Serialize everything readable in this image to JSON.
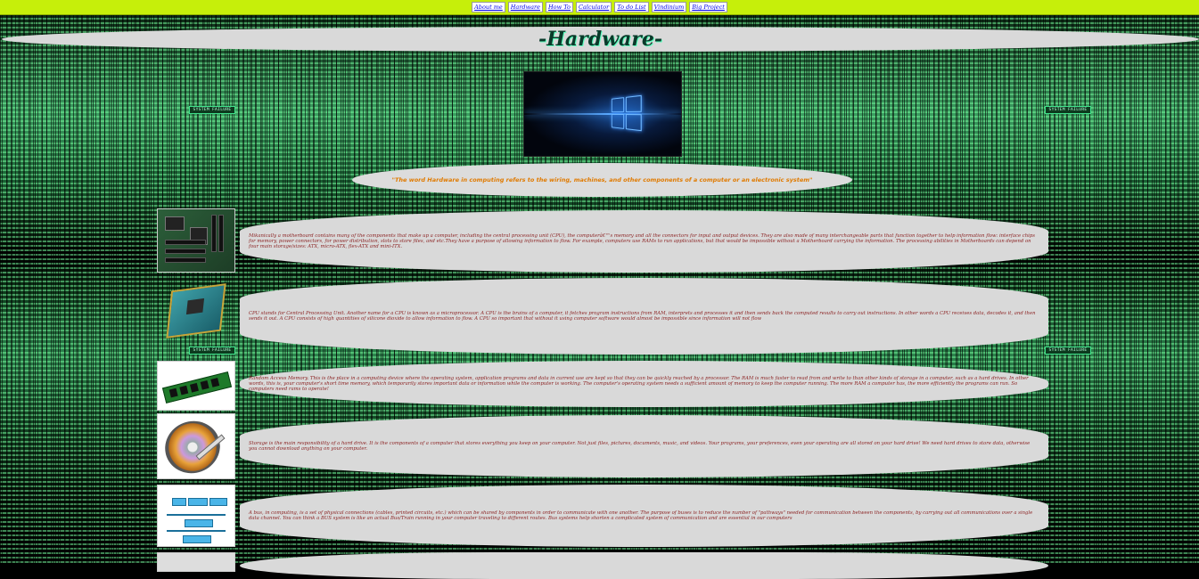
{
  "nav": {
    "links": [
      "About me",
      "Hardware",
      "How To",
      "Calculator",
      "To do List",
      "Vindinium",
      "Big Project"
    ]
  },
  "header": {
    "title": "-Hardware-"
  },
  "quote": "\"The word Hardware in computing refers to the wiring, machines, and other components of a computer or an electronic system\"",
  "badges": {
    "label": "SYSTEM FAILURE"
  },
  "sections": [
    {
      "icon": "motherboard-image",
      "text": "Mikanically a motherboard contains many of the components that make up a computer, including the central processing unit (CPU), the computerâ€™s memory and all the connectors for input and output devices. They are also made of many interchangeable parts that function together to help information flow: interface chips for memory, power connectors, for power distribution, slots to store files, and etc.They have a purpose of allowing information to flow. For example, computers use RAMs to run applications, but that would be impossible without a Motherboard carrying the information. The processing abilities in Motherboards can depend on four main storage/sizes: ATX, micro-ATX, flex-ATX and mini-ITX."
    },
    {
      "icon": "cpu-image",
      "text": "CPU stands for Central Processing Unit. Another name for a CPU is known as a microprocessor. A CPU is the brains of a computer, it fetches program instructions from RAM, interprets and processes it and then sends back the computed results to carry out instructions. In other words a CPU receives data, decodes it, and then sends it out. A CPU consists of high quantities of silicone dioxide to allow information to flow. A CPU so important that without it using computer software would almost be impossible since information will not flow"
    },
    {
      "icon": "ram-image",
      "text": "Random Access Memory. This is the place in a computing device where the operating system, application programs and data in current use are kept so that they can be quickly reached by a processor. The RAM is much faster to read from and write to than other kinds of storage in a computer, such as a hard drives. In other words, this is, your computer's short time memory, which temporarily stores important data or information while the computer is working. The computer's operating system needs a sufficient amount of memory to keep the computer running. The more RAM a computer has, the more efficiently the programs can run. So computers need rams to operate!"
    },
    {
      "icon": "hard-drive-image",
      "text": "Storage is the main responsibility of a hard drive. It is the components of a computer that stores everything you keep on your computer. Not just files, pictures, documents, music, and videos. Your programs, your preferences, even your operating are all stored on your hard drive! We need hard drives to store data, otherwise you cannot download anything on your computer."
    },
    {
      "icon": "bus-diagram-image",
      "text": "A bus, in computing, is a set of physical connections (cables, printed circuits, etc.) which can be shared by components in order to communicate with one another. The purpose of buses is to reduce the number of \"pathways\" needed for communication between the components, by carrying out all communications over a single data channel. You can think a BUS system is like an actual Bus/Train running in your computer traveling to different routes. Bus systems help shorten a complicated system of communication and are essential in our computers"
    }
  ]
}
